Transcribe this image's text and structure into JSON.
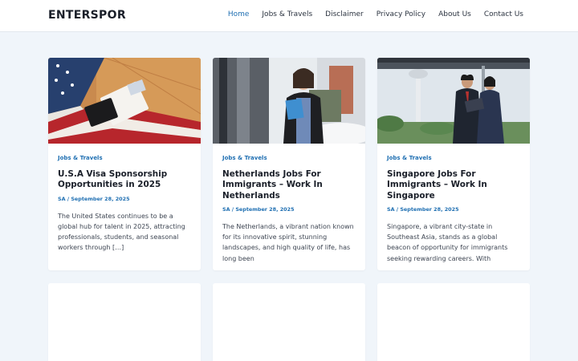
{
  "site": {
    "logo": "ENTERSPOR"
  },
  "nav": {
    "items": [
      {
        "label": "Home",
        "active": true
      },
      {
        "label": "Jobs & Travels"
      },
      {
        "label": "Disclaimer"
      },
      {
        "label": "Privacy Policy"
      },
      {
        "label": "About Us"
      },
      {
        "label": "Contact Us"
      }
    ]
  },
  "colors": {
    "accent": "#1f6fb2",
    "background": "#f0f5fa"
  },
  "posts": [
    {
      "category": "Jobs & Travels",
      "title": "U.S.A Visa Sponsorship Opportunities in 2025",
      "meta": "SA / September 28, 2025",
      "excerpt": "The United States continues to be a global hub for talent in 2025, attracting professionals, students, and seasonal workers through […]"
    },
    {
      "category": "Jobs & Travels",
      "title": "Netherlands Jobs For Immigrants – Work In Netherlands",
      "meta": "SA / September 28, 2025",
      "excerpt": "The Netherlands, a vibrant nation known for its innovative spirit, stunning landscapes, and high quality of life, has long been"
    },
    {
      "category": "Jobs & Travels",
      "title": "Singapore Jobs For Immigrants – Work In Singapore",
      "meta": "SA / September 28, 2025",
      "excerpt": "Singapore, a vibrant city-state in Southeast Asia, stands as a global beacon of opportunity for immigrants seeking rewarding careers. With"
    }
  ]
}
